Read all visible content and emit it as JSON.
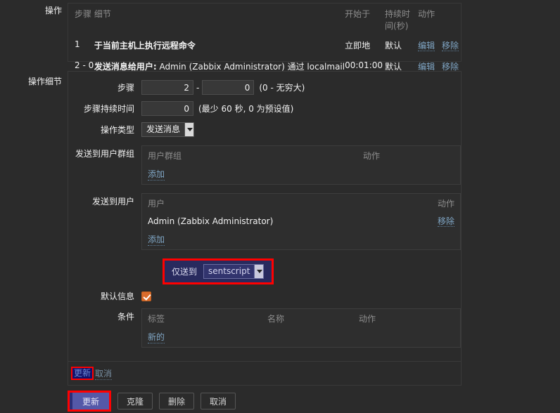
{
  "operations": {
    "section_label": "操作",
    "columns": [
      "步骤",
      "细节",
      "开始于",
      "持续时间(秒)",
      "动作"
    ],
    "rows": [
      {
        "step": "1",
        "detail": "于当前主机上执行远程命令",
        "detail_bold": "",
        "start": "立即地",
        "duration": "默认",
        "edit": "编辑",
        "remove": "移除"
      },
      {
        "step": "2 - 0",
        "detail_bold": "发送消息给用户:",
        "detail": " Admin (Zabbix Administrator) 通过 localmail",
        "start": "00:01:00",
        "duration": "默认",
        "edit": "编辑",
        "remove": "移除"
      }
    ]
  },
  "operation_details": {
    "section_label": "操作细节",
    "step": {
      "label": "步骤",
      "from": "2",
      "to": "0",
      "hint": "(0 - 无穷大)"
    },
    "step_duration": {
      "label": "步骤持续时间",
      "value": "0",
      "hint": "(最少 60 秒, 0 为预设值)"
    },
    "operation_type": {
      "label": "操作类型",
      "value": "发送消息"
    },
    "send_to_user_groups": {
      "label": "发送到用户群组",
      "col_name": "用户群组",
      "col_action": "动作",
      "rows": [],
      "add_label": "添加"
    },
    "send_to_users": {
      "label": "发送到用户",
      "col_name": "用户",
      "col_action": "动作",
      "rows": [
        {
          "name": "Admin (Zabbix Administrator)",
          "action": "移除"
        }
      ],
      "add_label": "添加"
    },
    "send_only_to": {
      "label": "仅送到",
      "value": "sentscript",
      "highlight_color": "#ff0000",
      "selection_color": "#282a5e"
    },
    "default_message": {
      "label": "默认信息",
      "checked": true,
      "checkbox_color": "#d96c2c"
    },
    "conditions": {
      "label": "条件",
      "col_label": "标签",
      "col_name": "名称",
      "col_action": "动作",
      "rows": [],
      "new_label": "新的"
    },
    "footer": {
      "update_label": "更新",
      "cancel_label": "取消"
    }
  },
  "bottom_buttons": {
    "update": "更新",
    "clone": "克隆",
    "delete": "删除",
    "cancel": "取消",
    "primary_color": "#5458a8"
  }
}
